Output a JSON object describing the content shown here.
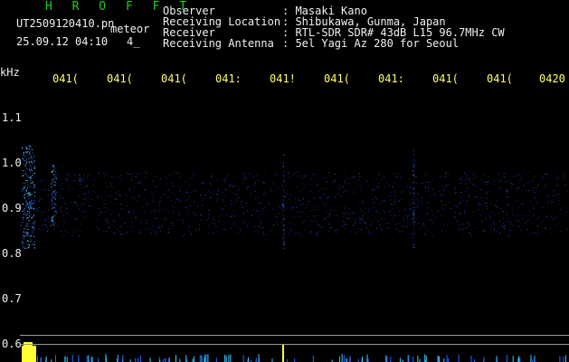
{
  "header": {
    "title": "H R O F F T",
    "filename": "UT2509120410.pn",
    "suffix": "meteor",
    "datetime": "25.09.12 04:10",
    "count": "4_",
    "info_labels": [
      "Observer",
      "Receiving Location",
      "Receiver",
      "Receiving Antenna"
    ],
    "info_values": [
      ": Masaki Kano",
      ": Shibukawa, Gunma, Japan",
      ": RTL-SDR SDR# 43dB L15 96.7MHz CW",
      ": 5el Yagi Az 280 for Seoul"
    ]
  },
  "time_axis": [
    "041(",
    "041(",
    "041(",
    "041:",
    "041!",
    "041(",
    "041:",
    "041(",
    "041(",
    "0420"
  ],
  "freq_axis": {
    "unit": "kHz",
    "ticks": [
      "1.1",
      "1.0",
      "0.9",
      "0.8",
      "0.7",
      "0.6"
    ]
  },
  "colors": {
    "background": "#000000",
    "header_title": "#22cc22",
    "time_labels": "#ffff66",
    "signal_bright": "#7fd8ff",
    "signal_dim": "#1a2a88"
  }
}
